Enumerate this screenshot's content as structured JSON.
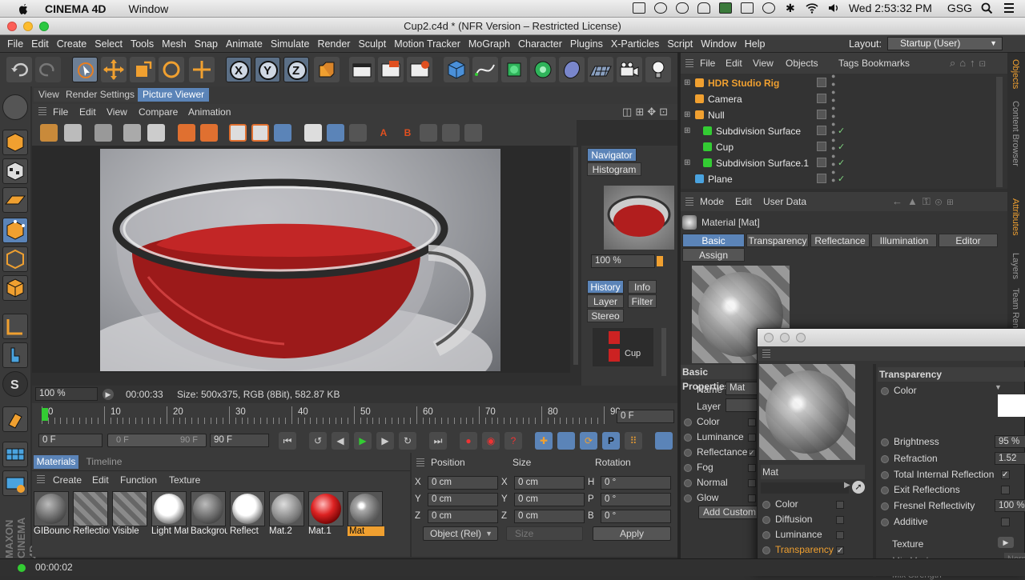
{
  "os_menu": {
    "app": "CINEMA 4D",
    "window": "Window",
    "clock": "Wed 2:53:32 PM",
    "user": "GSG"
  },
  "window_title": "Cup2.c4d * (NFR Version – Restricted License)",
  "menu": [
    "File",
    "Edit",
    "Create",
    "Select",
    "Tools",
    "Mesh",
    "Snap",
    "Animate",
    "Simulate",
    "Render",
    "Sculpt",
    "Motion Tracker",
    "MoGraph",
    "Character",
    "Plugins",
    "X-Particles",
    "Script",
    "Window",
    "Help"
  ],
  "layout": {
    "label": "Layout:",
    "value": "Startup (User)"
  },
  "viewport_tabs": [
    "View",
    "Render Settings",
    "Picture Viewer"
  ],
  "pv_menu": [
    "File",
    "Edit",
    "View",
    "Compare",
    "Animation"
  ],
  "pv_side": {
    "navigator": "Navigator",
    "histogram": "Histogram",
    "zoom": "100 %",
    "history": "History",
    "info": "Info",
    "layer": "Layer",
    "filter": "Filter",
    "stereo": "Stereo",
    "hist_item": "Cup"
  },
  "pv_status": {
    "zoom": "100 %",
    "time": "00:00:33",
    "size": "Size: 500x375, RGB (8Bit), 582.87 KB"
  },
  "timeline": {
    "ticks": [
      "0",
      "10",
      "20",
      "30",
      "40",
      "50",
      "60",
      "70",
      "80",
      "90"
    ],
    "frame": "0 F",
    "start": "0 F",
    "min": "0 F",
    "max": "90 F",
    "end": "90 F"
  },
  "materials": {
    "tabs": [
      "Materials",
      "Timeline"
    ],
    "menu": [
      "Create",
      "Edit",
      "Function",
      "Texture"
    ],
    "items": [
      {
        "name": "GIBounce",
        "type": "grey"
      },
      {
        "name": "Reflection",
        "type": "stripes"
      },
      {
        "name": "Visible",
        "type": "stripes"
      },
      {
        "name": "Light Mat",
        "type": "white"
      },
      {
        "name": "Background",
        "type": "grey"
      },
      {
        "name": "Reflect",
        "type": "white"
      },
      {
        "name": "Mat.2",
        "type": "grey2"
      },
      {
        "name": "Mat.1",
        "type": "red"
      },
      {
        "name": "Mat",
        "type": "glass"
      }
    ]
  },
  "coords": {
    "headers": [
      "Position",
      "Size",
      "Rotation"
    ],
    "rows": [
      {
        "a": "X",
        "av": "0 cm",
        "b": "X",
        "bv": "0 cm",
        "c": "H",
        "cv": "0 °"
      },
      {
        "a": "Y",
        "av": "0 cm",
        "b": "Y",
        "bv": "0 cm",
        "c": "P",
        "cv": "0 °"
      },
      {
        "a": "Z",
        "av": "0 cm",
        "b": "Z",
        "bv": "0 cm",
        "c": "B",
        "cv": "0 °"
      }
    ],
    "mode": "Object (Rel)",
    "size_mode": "Size",
    "apply": "Apply"
  },
  "objects": {
    "menu": [
      "File",
      "Edit",
      "View",
      "Objects",
      "Tags",
      "Bookmarks"
    ],
    "items": [
      {
        "name": "HDR Studio Rig",
        "color": "#f0a030"
      },
      {
        "name": "Camera",
        "color": "#e8e8e8"
      },
      {
        "name": "Null",
        "color": "#e8e8e8"
      },
      {
        "name": "Subdivision Surface",
        "color": "#e8e8e8"
      },
      {
        "name": "Cup",
        "color": "#e8e8e8"
      },
      {
        "name": "Subdivision Surface.1",
        "color": "#e8e8e8"
      },
      {
        "name": "Plane",
        "color": "#e8e8e8"
      }
    ]
  },
  "attributes": {
    "menu": [
      "Mode",
      "Edit",
      "User Data"
    ],
    "title": "Material [Mat]",
    "tabs": [
      "Basic",
      "Transparency",
      "Reflectance",
      "Illumination",
      "Editor",
      "Assign"
    ],
    "basic_title": "Basic Properties",
    "name_label": "Name",
    "name_value": "Mat",
    "layer_label": "Layer",
    "channels": [
      "Color",
      "Luminance",
      "Reflectance",
      "Fog",
      "Normal",
      "Glow"
    ],
    "add_custom": "Add Custom"
  },
  "popup": {
    "mat_name": "Mat",
    "channels": [
      {
        "name": "Color",
        "checked": false
      },
      {
        "name": "Diffusion",
        "checked": false
      },
      {
        "name": "Luminance",
        "checked": false
      },
      {
        "name": "Transparency",
        "checked": true,
        "active": true
      },
      {
        "name": "Reflectance",
        "checked": true
      }
    ],
    "section": "Transparency",
    "props": [
      {
        "name": "Color",
        "value": ""
      },
      {
        "name": "Brightness",
        "value": "95 %"
      },
      {
        "name": "Refraction",
        "value": "1.52"
      },
      {
        "name": "Total Internal Reflection",
        "value": "✓"
      },
      {
        "name": "Exit Reflections",
        "value": ""
      },
      {
        "name": "Fresnel Reflectivity",
        "value": "100 %"
      },
      {
        "name": "Additive",
        "value": ""
      }
    ],
    "texture": "Texture",
    "mix_mode": "Mix Mode",
    "mix_mode_val": "Norm",
    "mix_strength": "Mix Strength"
  },
  "side_tabs": [
    "Objects",
    "Content Browser",
    "Attributes",
    "Layers",
    "Team Render"
  ],
  "status": {
    "time": "00:00:02"
  },
  "brand": "MAXON CINEMA 4D"
}
